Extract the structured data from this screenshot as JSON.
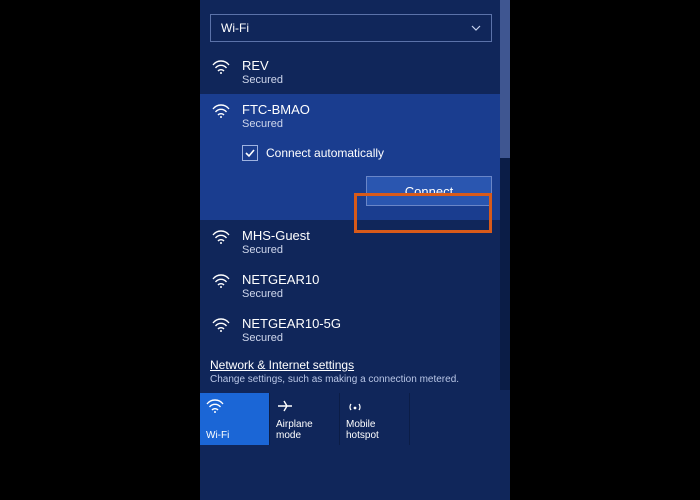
{
  "adapter": {
    "label": "Wi-Fi"
  },
  "networks": [
    {
      "name": "REV",
      "status": "Secured"
    },
    {
      "name": "FTC-BMAO",
      "status": "Secured",
      "selected": true
    },
    {
      "name": "MHS-Guest",
      "status": "Secured"
    },
    {
      "name": "NETGEAR10",
      "status": "Secured"
    },
    {
      "name": "NETGEAR10-5G",
      "status": "Secured"
    }
  ],
  "selectedNetwork": {
    "autoConnectLabel": "Connect automatically",
    "autoConnectChecked": true,
    "connectLabel": "Connect"
  },
  "settings": {
    "link": "Network & Internet settings",
    "sub": "Change settings, such as making a connection metered."
  },
  "tiles": {
    "wifi": "Wi-Fi",
    "airplane": "Airplane mode",
    "hotspot": "Mobile hotspot"
  }
}
